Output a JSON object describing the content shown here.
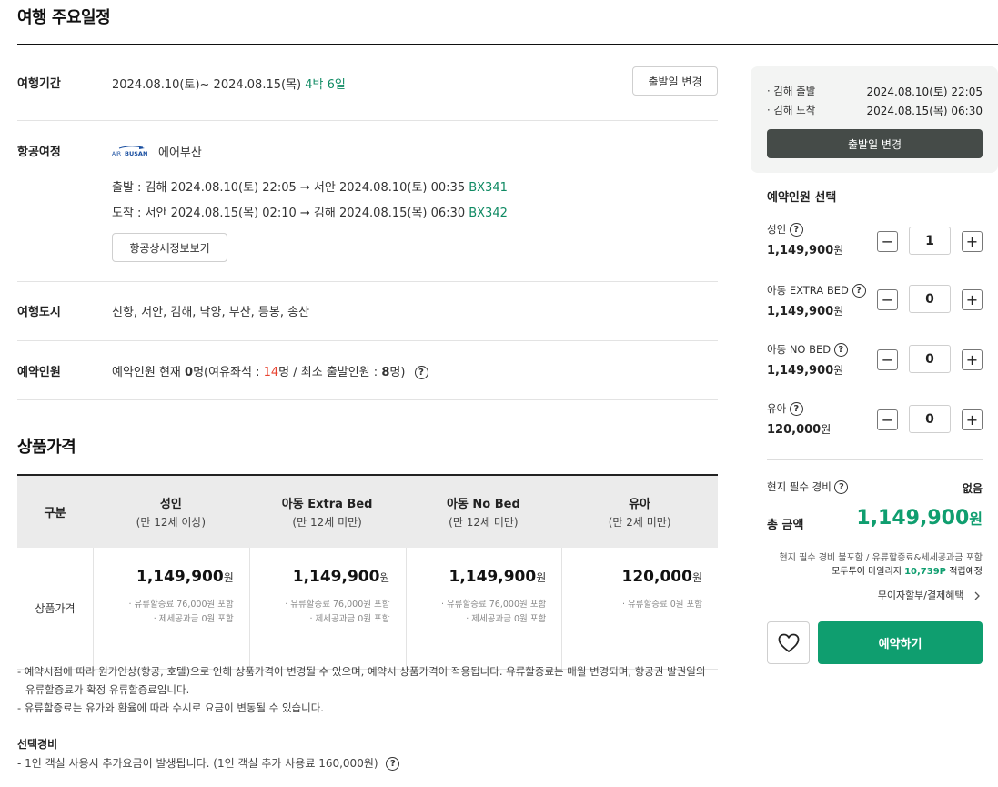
{
  "page": {
    "title": "여행 주요일정"
  },
  "schedule": {
    "period_label": "여행기간",
    "period_dates": "2024.08.10(토)~ 2024.08.15(목)",
    "period_nights": "4박 6일",
    "change_date_button": "출발일 변경",
    "flight_label": "항공여정",
    "airline_name": "에어부산",
    "airline_logo_text_top": "AIR",
    "airline_logo_text_bottom": "BUSAN",
    "departure_text": "출발 : 김해 2024.08.10(토) 22:05 → 서안 2024.08.10(토) 00:35",
    "departure_flight": "BX341",
    "arrival_text": "도착 : 서안 2024.08.15(목) 02:10 → 김해 2024.08.15(목) 06:30",
    "arrival_flight": "BX342",
    "flight_detail_button": "항공상세정보보기",
    "cities_label": "여행도시",
    "cities_text": "신향, 서안, 김해, 낙양, 부산, 등봉, 송산",
    "people_label": "예약인원",
    "people_text_1": "예약인원 현재",
    "people_current": "0",
    "people_text_2": "명(여유좌석 :",
    "people_available": "14",
    "people_text_3": "명 / 최소 출발인원 :",
    "people_min": "8",
    "people_text_4": "명)"
  },
  "price": {
    "section_title": "상품가격",
    "head_col0": "구분",
    "columns": [
      {
        "name": "성인",
        "sub": "(만 12세 이상)",
        "price": "1,149,900",
        "note1": "· 유류할증료 76,000원 포함",
        "note2": "· 제세공과금 0원 포함"
      },
      {
        "name": "아동 Extra Bed",
        "sub": "(만 12세 미만)",
        "price": "1,149,900",
        "note1": "· 유류할증료 76,000원 포함",
        "note2": "· 제세공과금 0원 포함"
      },
      {
        "name": "아동 No Bed",
        "sub": "(만 12세 미만)",
        "price": "1,149,900",
        "note1": "· 유류할증료 76,000원 포함",
        "note2": "· 제세공과금 0원 포함"
      },
      {
        "name": "유아",
        "sub": "(만 2세 미만)",
        "price": "120,000",
        "note1": "· 유류할증료 0원 포함",
        "note2": ""
      }
    ],
    "row_label": "상품가격",
    "won": "원"
  },
  "notes": {
    "line1": "-  예약시점에 따라 원가인상(항공, 호텔)으로 인해 상품가격이 변경될 수 있으며, 예약시 상품가격이 적용됩니다. 유류할증료는 매월 변경되며, 항공권 발권일의",
    "line1b": "유류할증료가 확정 유류할증료입니다.",
    "line2": "- 유류할증료는 유가와 환율에 따라 수시로 요금이 변동될 수 있습니다.",
    "select_title": "선택경비",
    "select_line": "- 1인 객실 사용시 추가요금이 발생됩니다. (1인 객실 추가 사용료 160,000원)"
  },
  "sidebar": {
    "depart_label": "· 김해 출발",
    "depart_value": "2024.08.10(토) 22:05",
    "arrive_label": "· 김해 도착",
    "arrive_value": "2024.08.15(목) 06:30",
    "change_date_button": "출발일 변경",
    "people_title": "예약인원 선택",
    "people": [
      {
        "label": "성인",
        "price": "1,149,900",
        "count": "1"
      },
      {
        "label": "아동 EXTRA BED",
        "price": "1,149,900",
        "count": "0"
      },
      {
        "label": "아동 NO BED",
        "price": "1,149,900",
        "count": "0"
      },
      {
        "label": "유아",
        "price": "120,000",
        "count": "0"
      }
    ],
    "won": "원",
    "minus": "−",
    "plus": "+",
    "local_fee_label": "현지 필수 경비",
    "local_fee_value": "없음",
    "total_label": "총 금액",
    "total_value": "1,149,900",
    "total_note1": "현지 필수 경비 불포함 / 유류할증료&세세공과금 포함",
    "total_note2_a": "모두투어 마일리지",
    "total_note2_mileage": "10,739P",
    "total_note2_b": "적립예정",
    "installment": "무이자할부/결제혜택",
    "reserve_button": "예약하기"
  },
  "colors": {
    "accent_green": "#0f9e6f",
    "dark_button": "#454b48",
    "red": "#e8422f"
  },
  "icons": [
    "question-icon",
    "chevron-right-icon",
    "heart-icon",
    "airline-logo"
  ]
}
